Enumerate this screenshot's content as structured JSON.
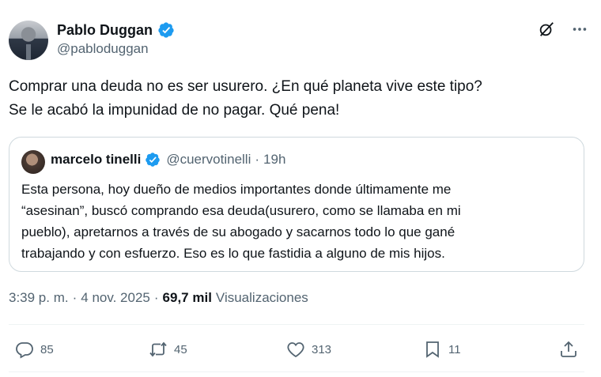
{
  "author": {
    "name": "Pablo Duggan",
    "handle": "@pabloduggan"
  },
  "tweet": {
    "lines": [
      "Comprar una deuda no es ser usurero. ¿En qué planeta vive este tipo?",
      "Se le acabó la impunidad de no pagar. Qué pena!"
    ]
  },
  "quote": {
    "name": "marcelo tinelli",
    "handle": "@cuervotinelli",
    "separator": "·",
    "time": "19h",
    "lines": [
      "Esta persona, hoy dueño de medios importantes donde últimamente me",
      "“asesinan”, buscó comprando esa deuda(usurero, como se llamaba en mi",
      "pueblo), apretarnos a través de su abogado y sacarnos todo lo que gané",
      "trabajando y con esfuerzo. Eso es lo que fastidia a alguno de mis hijos."
    ]
  },
  "meta": {
    "time": "3:39 p. m.",
    "separator": "·",
    "date": "4 nov. 2025",
    "views_count": "69,7 mil",
    "views_label": "Visualizaciones"
  },
  "actions": {
    "replies": "85",
    "reposts": "45",
    "likes": "313",
    "bookmarks": "11"
  },
  "colors": {
    "verified": "#1d9bf0",
    "secondary_text": "#536471",
    "border": "#cfd9de"
  },
  "icons": [
    "verified-badge-icon",
    "grok-icon",
    "more-icon",
    "reply-icon",
    "repost-icon",
    "like-icon",
    "bookmark-icon",
    "share-icon"
  ]
}
